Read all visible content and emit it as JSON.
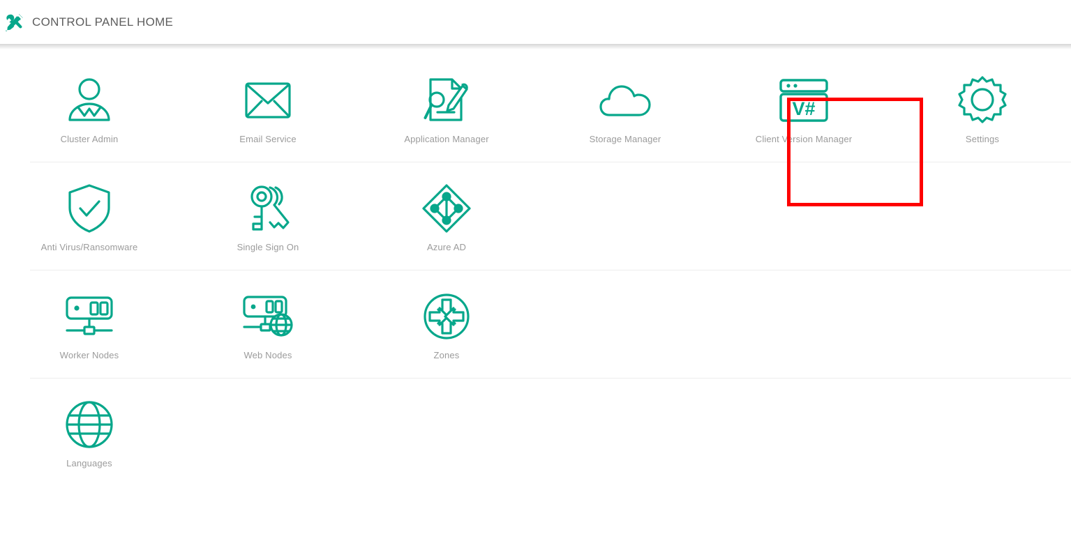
{
  "header": {
    "title": "CONTROL PANEL HOME",
    "icon": "tools-icon"
  },
  "theme": {
    "accent": "#07a78b",
    "label_color": "#9b9b9b",
    "title_color": "#5e5e5e",
    "divider_color": "#ededed",
    "highlight_color": "#fe0000",
    "background": "#ffffff"
  },
  "highlight": {
    "target": "Client Version Manager",
    "color": "#fe0000"
  },
  "grid": {
    "rows": [
      {
        "items": [
          {
            "label": "Cluster Admin",
            "icon": "user-admin-icon"
          },
          {
            "label": "Email Service",
            "icon": "envelope-icon"
          },
          {
            "label": "Application Manager",
            "icon": "document-search-pencil-icon"
          },
          {
            "label": "Storage Manager",
            "icon": "cloud-icon"
          },
          {
            "label": "Client Version Manager",
            "icon": "browser-version-icon",
            "icon_text": "V#",
            "highlighted": true
          },
          {
            "label": "Settings",
            "icon": "gear-icon"
          }
        ]
      },
      {
        "items": [
          {
            "label": "Anti Virus/Ransomware",
            "icon": "shield-check-icon"
          },
          {
            "label": "Single Sign On",
            "icon": "keys-icon"
          },
          {
            "label": "Azure AD",
            "icon": "diamond-network-icon"
          }
        ]
      },
      {
        "items": [
          {
            "label": "Worker Nodes",
            "icon": "server-node-icon"
          },
          {
            "label": "Web Nodes",
            "icon": "server-globe-icon"
          },
          {
            "label": "Zones",
            "icon": "circle-arrows-icon"
          }
        ]
      },
      {
        "items": [
          {
            "label": "Languages",
            "icon": "globe-icon"
          }
        ]
      }
    ]
  }
}
